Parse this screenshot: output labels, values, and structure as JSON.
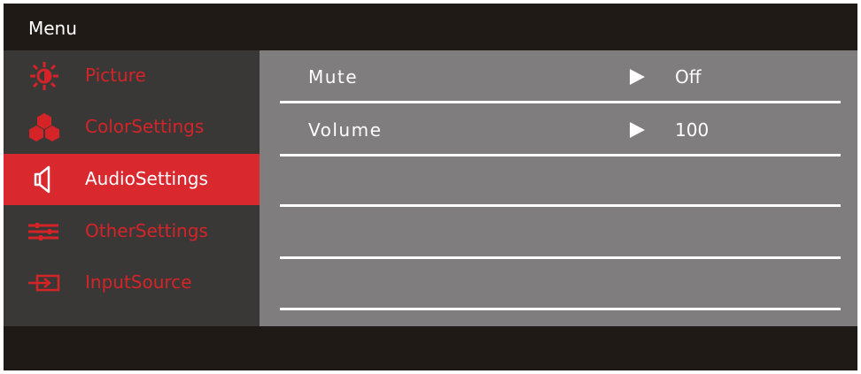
{
  "menu": {
    "title": "Menu"
  },
  "sidebar": {
    "items": [
      {
        "label": "Picture",
        "icon": "sun-icon",
        "active": false
      },
      {
        "label": "ColorSettings",
        "icon": "color-dots-icon",
        "active": false
      },
      {
        "label": "AudioSettings",
        "icon": "speaker-icon",
        "active": true
      },
      {
        "label": "OtherSettings",
        "icon": "sliders-icon",
        "active": false
      },
      {
        "label": "InputSource",
        "icon": "input-arrow-icon",
        "active": false
      }
    ]
  },
  "settings": {
    "rows": [
      {
        "name": "Mute",
        "value": "Off"
      },
      {
        "name": "Volume",
        "value": "100"
      },
      {
        "name": "",
        "value": ""
      },
      {
        "name": "",
        "value": ""
      },
      {
        "name": "",
        "value": ""
      }
    ]
  },
  "colors": {
    "accent": "#d9282e",
    "frame": "#201a16",
    "sidebar_bg": "#3a3837",
    "content_bg": "#7f7d7e"
  }
}
